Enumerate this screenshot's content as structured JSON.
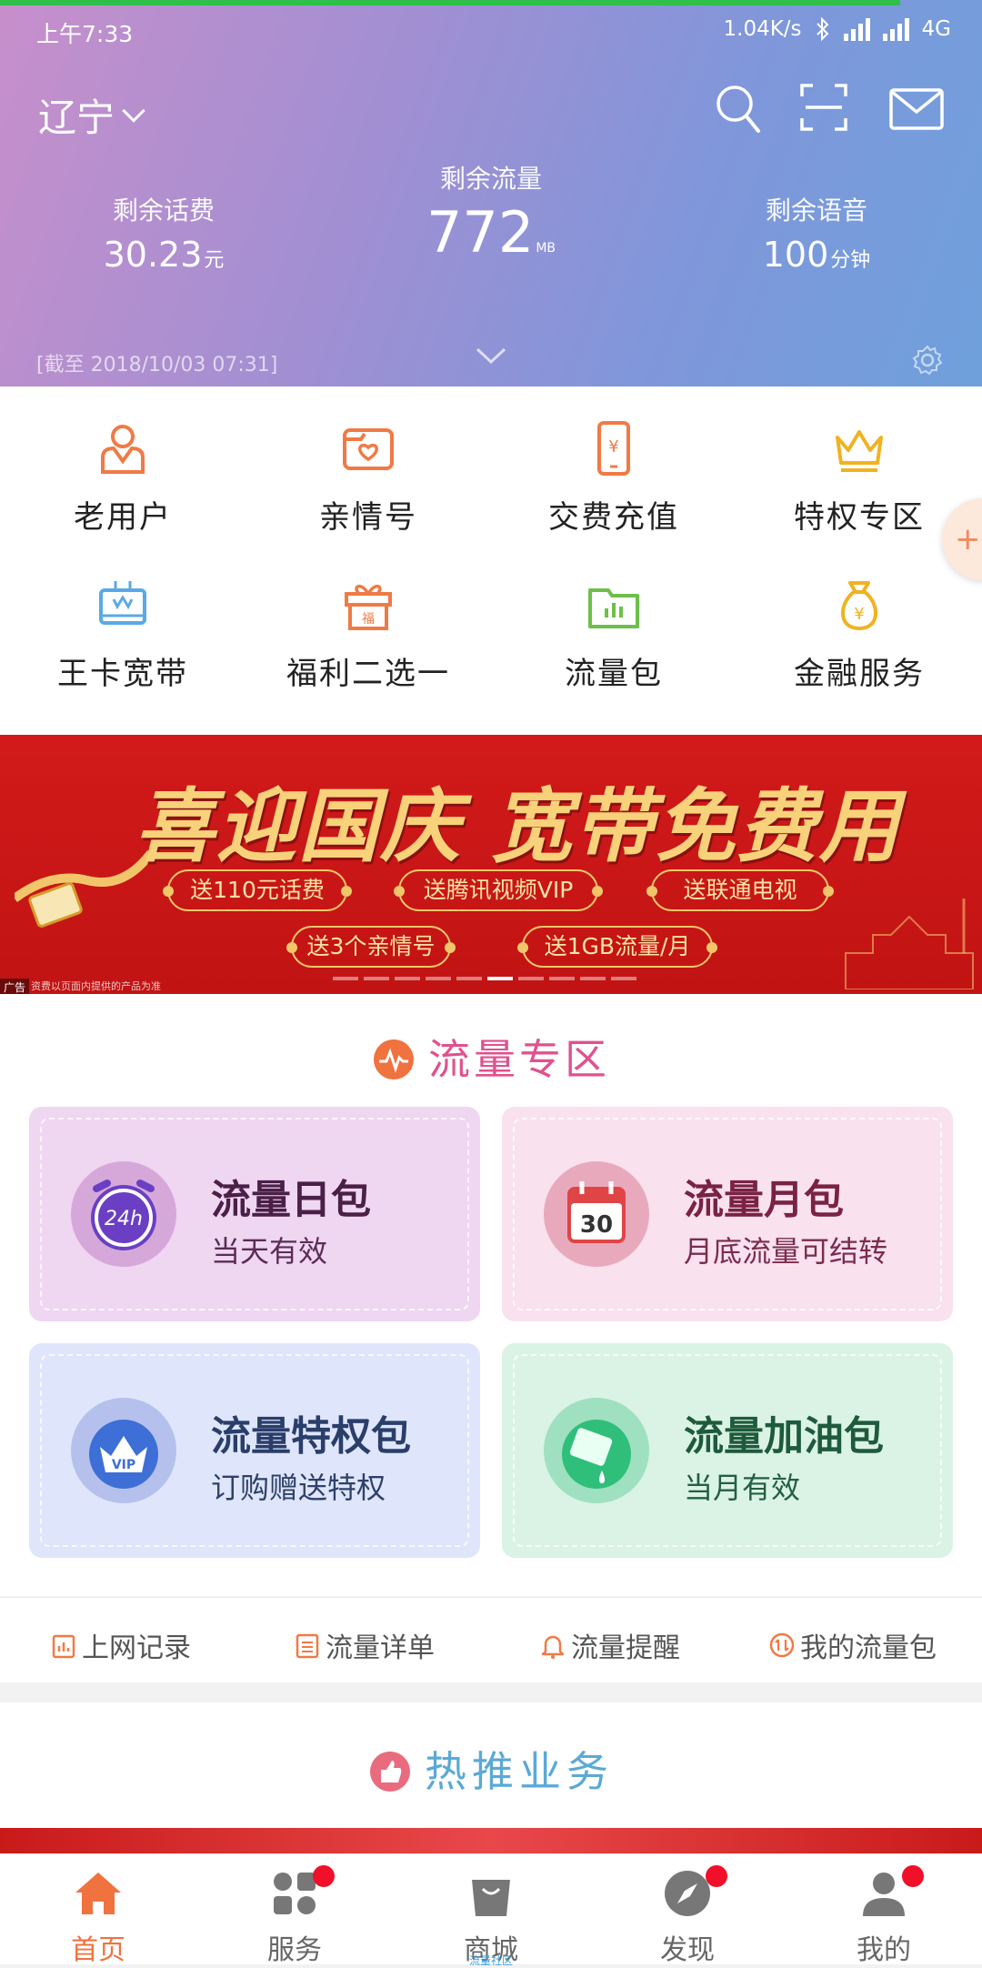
{
  "status": {
    "time": "上午7:33",
    "net_speed": "1.04K/s",
    "network": "4G"
  },
  "header": {
    "province": "辽宁",
    "balance_label": "剩余话费",
    "balance_value": "30.23",
    "balance_unit": "元",
    "data_label": "剩余流量",
    "data_value": "772",
    "data_unit": "MB",
    "voice_label": "剩余语音",
    "voice_value": "100",
    "voice_unit": "分钟",
    "as_of": "[截至 2018/10/03 07:31]"
  },
  "quick": [
    {
      "label": "老用户",
      "icon": "old-user-icon",
      "color": "#f07a45"
    },
    {
      "label": "亲情号",
      "icon": "family-number-icon",
      "color": "#f07a45"
    },
    {
      "label": "交费充值",
      "icon": "recharge-icon",
      "color": "#f07a45"
    },
    {
      "label": "特权专区",
      "icon": "crown-icon",
      "color": "#f0b21f"
    },
    {
      "label": "王卡宽带",
      "icon": "broadband-icon",
      "color": "#5aa9e6"
    },
    {
      "label": "福利二选一",
      "icon": "gift-icon",
      "color": "#f07a45"
    },
    {
      "label": "流量包",
      "icon": "data-package-icon",
      "color": "#6cc04a"
    },
    {
      "label": "金融服务",
      "icon": "money-bag-icon",
      "color": "#f0b21f"
    }
  ],
  "float_plus": "+",
  "banner": {
    "title": "喜迎国庆 宽带免费用",
    "pills": [
      "送110元话费",
      "送腾讯视频VIP",
      "送联通电视",
      "送3个亲情号",
      "送1GB流量/月"
    ],
    "ad_tag": "广告",
    "note": "资费以页面内提供的产品为准",
    "slide_count": 10,
    "active_slide": 6
  },
  "data_zone": {
    "title": "流量专区",
    "cards": [
      {
        "title": "流量日包",
        "subtitle": "当天有效",
        "icon_text": "24h"
      },
      {
        "title": "流量月包",
        "subtitle": "月底流量可结转",
        "icon_text": "30"
      },
      {
        "title": "流量特权包",
        "subtitle": "订购赠送特权",
        "icon_text": "VIP"
      },
      {
        "title": "流量加油包",
        "subtitle": "当月有效",
        "icon_text": ""
      }
    ],
    "links": [
      "上网记录",
      "流量详单",
      "流量提醒",
      "我的流量包"
    ]
  },
  "hot": {
    "title": "热推业务"
  },
  "tabs": [
    {
      "label": "首页",
      "active": true,
      "badge": false
    },
    {
      "label": "服务",
      "active": false,
      "badge": true
    },
    {
      "label": "商城",
      "active": false,
      "badge": false,
      "sub": "流量社区"
    },
    {
      "label": "发现",
      "active": false,
      "badge": true
    },
    {
      "label": "我的",
      "active": false,
      "badge": true
    }
  ],
  "colors": {
    "accent": "#f0723f",
    "badge": "#f0102a",
    "zone_title": "#e0518e",
    "hot_title": "#5aa9d6"
  }
}
